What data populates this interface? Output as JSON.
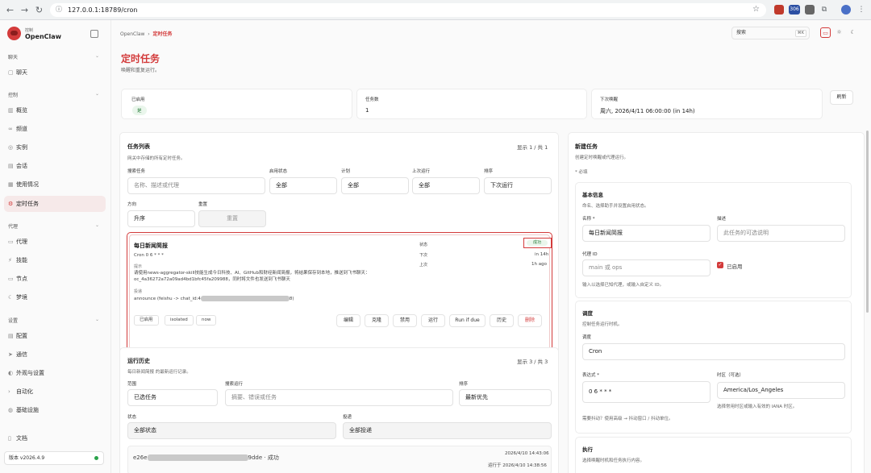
{
  "browser": {
    "url": "127.0.0.1:18789/cron",
    "ext_badge": "306"
  },
  "brand": {
    "sub": "控制",
    "name": "OpenClaw"
  },
  "sidebar": {
    "sections": [
      {
        "label": "聊天",
        "items": [
          "聊天"
        ]
      },
      {
        "label": "控制",
        "items": [
          "概览",
          "频道",
          "实例",
          "会话",
          "使用情况",
          "定时任务"
        ]
      },
      {
        "label": "代理",
        "items": [
          "代理",
          "技能",
          "节点",
          "梦境"
        ]
      },
      {
        "label": "设置",
        "items": [
          "配置",
          "通信",
          "外观与设置",
          "自动化",
          "基础设施"
        ]
      }
    ],
    "docs": "文档",
    "version": "版本 v2026.4.9"
  },
  "header": {
    "crumb_root": "OpenClaw",
    "crumb_current": "定时任务",
    "search_placeholder": "搜索",
    "search_kbd": "⌘K"
  },
  "page": {
    "title": "定时任务",
    "subtitle": "唤醒和重复运行。"
  },
  "stats": {
    "enabled_label": "已启用",
    "enabled_value": "是",
    "count_label": "任务数",
    "count_value": "1",
    "next_label": "下次唤醒",
    "next_value": "周六, 2026/4/11 06:00:00 (in 14h)",
    "refresh": "刷新"
  },
  "tasks": {
    "title": "任务列表",
    "subtitle": "网关中存储的所有定时任务。",
    "count": "显示 1 / 共 1",
    "filters": {
      "search_label": "搜索任务",
      "search_placeholder": "名称、描述或代理",
      "status_label": "启用状态",
      "status_value": "全部",
      "plan_label": "计划",
      "plan_value": "全部",
      "last_label": "上次运行",
      "last_value": "全部",
      "sort_label": "排序",
      "sort_value": "下次运行",
      "dir_label": "方向",
      "dir_value": "升序",
      "reset_label": "重置",
      "reset_btn": "重置"
    },
    "job": {
      "name": "每日新闻简报",
      "schedule": "Cron 0 6 * * *",
      "prompt_label": "提示",
      "prompt_text": "请使用news-aggregator-skill技能生成今日科技、AI、GitHub和财经新闻简报，将结果保存到本地，推送到飞书聊天：oc_4a36272a72a09ad4bd1bfc45fa209988，同时将文件也发送到飞书聊天",
      "delivery_label": "投递",
      "delivery_prefix": "announce (feishu -> chat_id:4",
      "delivery_suffix": "8)",
      "status_label": "状态",
      "status_value": "成功",
      "next_label": "下次",
      "next_value": "in 14h",
      "last_label": "上次",
      "last_value": "1h ago",
      "tags": [
        "已启用",
        "isolated",
        "now"
      ],
      "actions": [
        "编辑",
        "克隆",
        "禁用",
        "运行",
        "Run if due",
        "历史",
        "删除"
      ]
    }
  },
  "history": {
    "title": "运行历史",
    "subtitle": "每日新闻简报 的最新运行记录。",
    "count": "显示 3 / 共 3",
    "scope_label": "范围",
    "scope_value": "已选任务",
    "search_label": "搜索运行",
    "search_placeholder": "摘要、错误或任务",
    "sort_label": "排序",
    "sort_value": "最新优先",
    "status_label": "状态",
    "status_value": "全部状态",
    "delivery_label": "投递",
    "delivery_value": "全部投递",
    "row": {
      "id_prefix": "e26e",
      "id_suffix": "9dde · 成功",
      "time": "2026/4/10 14:43:06",
      "ran": "运行于 2026/4/10 14:38:56"
    }
  },
  "newtask": {
    "title": "新建任务",
    "subtitle": "创建定时唤醒或代理运行。",
    "required": "* 必填",
    "basic": {
      "title": "基本信息",
      "subtitle": "命名、选择助手并设置启用状态。",
      "name_label": "名称 *",
      "name_value": "每日新闻简报",
      "desc_label": "描述",
      "desc_placeholder": "此任务的可选说明",
      "agent_label": "代理 ID",
      "agent_placeholder": "main 或 ops",
      "enabled_label": "已启用",
      "agent_hint": "输入以选择已知代理，或输入自定义 ID。"
    },
    "schedule": {
      "title": "调度",
      "subtitle": "控制任务运行时机。",
      "mode_label": "调度",
      "mode_value": "Cron",
      "expr_label": "表达式 *",
      "expr_value": "0 6 * * *",
      "tz_label": "时区（可选）",
      "tz_value": "America/Los_Angeles",
      "tz_hint": "选择常用时区或输入有效的 IANA 时区。",
      "expr_hint": "需要抖动？使用高级 → 抖动窗口 / 抖动单位。"
    },
    "exec": {
      "title": "执行",
      "subtitle": "选择唤醒时机和任务执行内容。"
    }
  }
}
